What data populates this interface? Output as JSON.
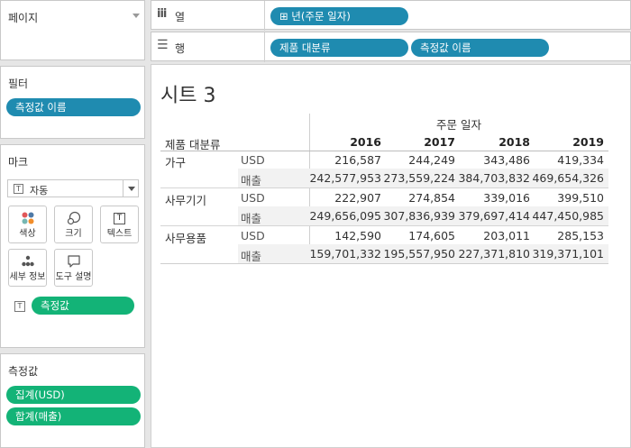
{
  "shelves": {
    "columns": {
      "icon": "iii",
      "label": "열",
      "pills": [
        "⊞ 년(주문 일자)"
      ]
    },
    "rows": {
      "icon": "☰",
      "label": "행",
      "pills": [
        "제품 대분류",
        "측정값 이름"
      ]
    }
  },
  "pages_card": {
    "title": "페이지"
  },
  "filters_card": {
    "title": "필터",
    "pills": [
      "측정값 이름"
    ]
  },
  "marks_card": {
    "title": "마크",
    "mark_type": "자동",
    "buttons": [
      "색상",
      "크기",
      "텍스트",
      "세부 정보",
      "도구 설명"
    ],
    "text_pill": "측정값"
  },
  "measures_card": {
    "title": "측정값",
    "pills": [
      "집계(USD)",
      "합계(매출)"
    ]
  },
  "view": {
    "title": "시트 3",
    "column_header": "주문 일자",
    "row_header": "제품 대분류",
    "years": [
      "2016",
      "2017",
      "2018",
      "2019"
    ],
    "rows": [
      {
        "category": "가구",
        "usd_label": "USD",
        "usd": [
          "216,587",
          "244,249",
          "343,486",
          "419,334"
        ],
        "sales_label": "매출",
        "sales": [
          "242,577,953",
          "273,559,224",
          "384,703,832",
          "469,654,326"
        ]
      },
      {
        "category": "사무기기",
        "usd_label": "USD",
        "usd": [
          "222,907",
          "274,854",
          "339,016",
          "399,510"
        ],
        "sales_label": "매출",
        "sales": [
          "249,656,095",
          "307,836,939",
          "379,697,414",
          "447,450,985"
        ]
      },
      {
        "category": "사무용품",
        "usd_label": "USD",
        "usd": [
          "142,590",
          "174,605",
          "203,011",
          "285,153"
        ],
        "sales_label": "매출",
        "sales": [
          "159,701,332",
          "195,557,950",
          "227,371,810",
          "319,371,101"
        ]
      }
    ]
  },
  "colors": {
    "dimension_pill": "#1f8bb0",
    "measure_pill": "#13b377",
    "band": "#f2f2f2"
  }
}
